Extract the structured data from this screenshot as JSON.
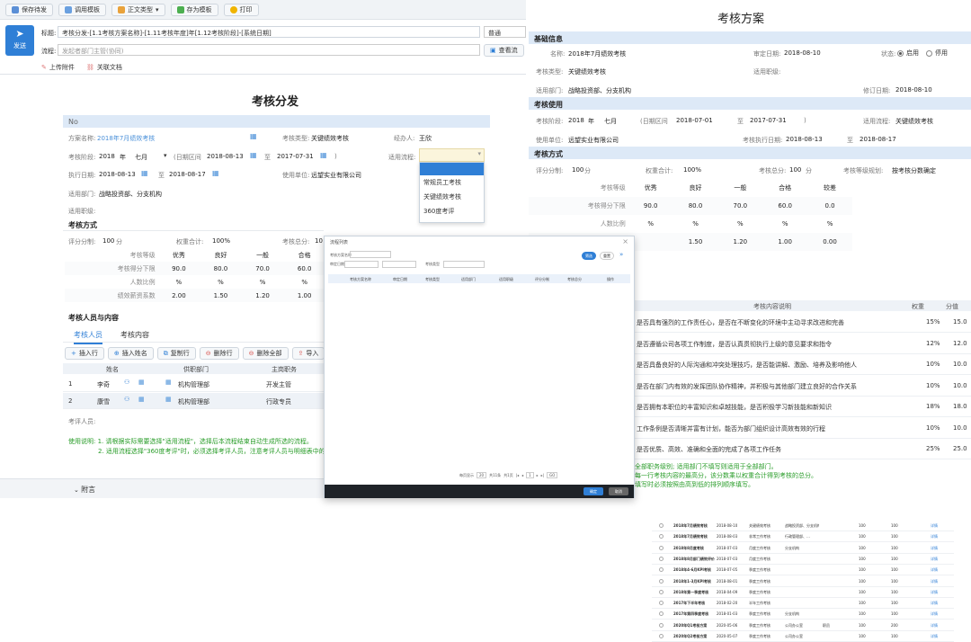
{
  "toolbar": {
    "save": "保存待发",
    "template": "调用模板",
    "body_type": "正文类型",
    "save_template": "存为模板",
    "print": "打印"
  },
  "send": {
    "label": "发送"
  },
  "title": {
    "label": "标题:",
    "value": "考核分发-[1.1考核方案名称]-[1.11考核年度]年[1.12考核阶段]-[系统日期]",
    "right": "普通"
  },
  "flow": {
    "label": "流程:",
    "placeholder": "发起者部门主管(协同)",
    "view": "查看流"
  },
  "attach": {
    "upload": "上传附件",
    "doc": "关联文档"
  },
  "left": {
    "heading": "考核分发",
    "no_label": "No",
    "plan_name_label": "方案名称:",
    "plan_name": "2018年7月绩效考核",
    "type_label": "考核类型:",
    "type": "关键绩效考核",
    "handler_label": "经办人:",
    "handler": "王欣",
    "stage_label": "考核阶段:",
    "stage_year": "2018",
    "stage_year_unit": "年",
    "stage_month": "七月",
    "range_label": "(日期区间",
    "range_start": "2018-08-13",
    "range_to": "至",
    "range_end": "2017-07-31",
    "range_close": ")",
    "process_label": "适用流程:",
    "exec_label": "执行日期:",
    "exec_start": "2018-08-13",
    "exec_to": "至",
    "exec_end": "2018-08-17",
    "unit_label": "使用单位:",
    "unit": "远望实业有限公司",
    "dept_label": "适用部门:",
    "dept": "战略投资部、分支机构",
    "post_label": "适用职级:",
    "method_heading": "考核方式",
    "score_label": "评分分制:",
    "score": "100",
    "score_unit": "分",
    "weight_label": "权重合计:",
    "weight": "100%",
    "total_label": "考核总分:",
    "total": "10",
    "grade_table": {
      "rows": [
        [
          "考核等级",
          "优秀",
          "良好",
          "一般",
          "合格"
        ],
        [
          "考核得分下限",
          "90.0",
          "80.0",
          "70.0",
          "60.0"
        ],
        [
          "人数比例",
          "%",
          "%",
          "%",
          "%"
        ],
        [
          "绩效薪资系数",
          "2.00",
          "1.50",
          "1.20",
          "1.00"
        ]
      ]
    },
    "staff_heading": "考核人员与内容",
    "tab_staff": "考核人员",
    "tab_content": "考核内容",
    "actions": [
      "插入行",
      "插入姓名",
      "复制行",
      "删除行",
      "删除全部",
      "导入"
    ],
    "staff_cols": [
      "姓名",
      "供职部门",
      "主岗职务"
    ],
    "staff_rows": [
      [
        "1",
        "李奇",
        "机构管理部",
        "开发主管"
      ],
      [
        "2",
        "康雪",
        "机构管理部",
        "行政专员"
      ]
    ],
    "reviewer_label": "考评人员:",
    "note1": "使用说明: 1. 请根据实际需要选择\"适用流程\"，选择后本流程结束自动生成所选的流程。",
    "note2": "2. 适用流程选择\"360度考评\"时，必须选择考评人员，注意考评人员与明细表中的人员",
    "footer": "附言"
  },
  "dropdown": {
    "options": [
      "",
      "常规员工考核",
      "关键绩效考核",
      "360度考评"
    ]
  },
  "modal": {
    "title": "流程列表",
    "filter1": "考核方案名称",
    "filter2": "审定日期",
    "filter3": "考核类型",
    "filter_btn": "筛选",
    "reset_btn": "重置",
    "cols": [
      "考核方案名称",
      "审定日期",
      "考核类型",
      "适用部门",
      "适用职级",
      "评分分制",
      "考核总分",
      "操作"
    ],
    "rows": [
      [
        "2018年7月绩效考核",
        "2018-08-10",
        "关键绩效考核",
        "战略投资部、分支机构",
        "",
        "100",
        "100",
        "详情"
      ],
      [
        "2018年7月绩效考核",
        "2018-08-03",
        "非常工作考核",
        "行政管理部、…",
        "",
        "100",
        "100",
        "详情"
      ],
      [
        "2018年8月度考核",
        "2018-07-03",
        "月度工作考核",
        "分支机构",
        "",
        "100",
        "100",
        "详情"
      ],
      [
        "2018年8月部门绩效评价",
        "2018-07-03",
        "月度工作考核",
        "",
        "",
        "100",
        "100",
        "详情"
      ],
      [
        "2018年4-6月KPI考核",
        "2018-07-05",
        "季度工作考核",
        "",
        "",
        "100",
        "100",
        "详情"
      ],
      [
        "2018年1-3月KPI考核",
        "2018-08-01",
        "季度工作考核",
        "",
        "",
        "100",
        "100",
        "详情"
      ],
      [
        "2018年第一季度考核",
        "2018-04-09",
        "季度工作考核",
        "",
        "",
        "100",
        "100",
        "详情"
      ],
      [
        "2017年下半年考核",
        "2018-02-20",
        "半年工作考核",
        "",
        "",
        "100",
        "100",
        "详情"
      ],
      [
        "2017年第四季度考核",
        "2018-01-03",
        "季度工作考核",
        "分支机构",
        "",
        "100",
        "100",
        "详情"
      ],
      [
        "2020年Q1考核方案",
        "2020-05-06",
        "季度工作考核",
        "公司办公室",
        "职员",
        "100",
        "200",
        "详情"
      ],
      [
        "2020年Q2考核方案",
        "2020-05-07",
        "季度工作考核",
        "公司办公室",
        "",
        "100",
        "100",
        "详情"
      ]
    ],
    "pager": {
      "size_label": "每页显示",
      "size": "20",
      "total": "共11条",
      "page_of": "共1页",
      "page": "1",
      "go": "GO"
    },
    "ok": "确定",
    "cancel": "取消"
  },
  "right": {
    "heading": "考核方案",
    "basic": "基础信息",
    "name_label": "名称:",
    "name": "2018年7月绩效考核",
    "approve_label": "审定日期:",
    "approve": "2018-08-10",
    "status_label": "状态:",
    "status_on": "启用",
    "status_off": "停用",
    "type_label": "考核类型:",
    "type": "关键绩效考核",
    "post_label": "适用职级:",
    "dept_label": "适用部门:",
    "dept": "战略投资部、分支机构",
    "revise_label": "修订日期:",
    "revise": "2018-08-10",
    "use_heading": "考核使用",
    "stage_label": "考核阶段:",
    "stage_year": "2018",
    "stage_year_unit": "年",
    "stage_month": "七月",
    "range_label": "(日期区间",
    "range_start": "2018-07-01",
    "range_to": "至",
    "range_end": "2017-07-31",
    "range_close": ")",
    "flow_label": "适用流程:",
    "flow": "关键绩效考核",
    "unit_label": "使用单位:",
    "unit": "远望实业有限公司",
    "exec_label": "考核执行日期:",
    "exec_start": "2018-08-13",
    "exec_to": "至",
    "exec_end": "2018-08-17",
    "method_heading": "考核方式",
    "score_label": "评分分制:",
    "score": "100",
    "score_unit": "分",
    "weight_label": "权重合计:",
    "weight": "100%",
    "total_label": "考核总分:",
    "total": "100",
    "total_unit": "分",
    "grade_label": "考核等级规划:",
    "grade": "按考核分数确定",
    "grade_table": {
      "rows": [
        [
          "考核等级",
          "优秀",
          "良好",
          "一般",
          "合格",
          "较差"
        ],
        [
          "考核得分下限",
          "90.0",
          "80.0",
          "70.0",
          "60.0",
          "0.0"
        ],
        [
          "人数比例",
          "%",
          "%",
          "%",
          "%",
          "%"
        ],
        [
          "",
          "",
          "1.50",
          "1.20",
          "1.00",
          "0.00"
        ]
      ]
    },
    "content_cols": [
      "考核内容说明",
      "权重",
      "分值"
    ],
    "content_rows": [
      [
        "是否具有强烈的工作责任心，是否在不断变化的环境中主动寻求改进和完善",
        "15%",
        "15.0"
      ],
      [
        "是否遵循公司各项工作制度，是否认真贯彻执行上级的意见要求和指令",
        "12%",
        "12.0"
      ],
      [
        "是否具备良好的人际沟通和冲突处理技巧，是否能讲解、激励、培养及影响他人",
        "10%",
        "10.0"
      ],
      [
        "是否在部门内有效的发挥团队协作精神，并积极与其他部门建立良好的合作关系",
        "10%",
        "10.0"
      ],
      [
        "是否拥有本职位的丰富知识和卓越技能，是否积极学习新技能和新知识",
        "18%",
        "18.0"
      ],
      [
        "工作条例是否清晰并富有计划，能否为部门组织设计高效有效的行程",
        "10%",
        "10.0"
      ],
      [
        "是否优质、高效、准确和全面的完成了各项工作任务",
        "25%",
        "25.0"
      ]
    ],
    "note1": "全部职务级别; 适用部门不填写则适用于全部部门。",
    "note2": "每一行考核内容的最高分，该分数乘以权重合计得到考核的总分。",
    "note3": "填写时必须按照由高到低的排列顺序填写。"
  },
  "colors": {
    "accent": "#2f7fd6",
    "section_bg": "#dde9f7",
    "note": "#2a9d2a"
  }
}
